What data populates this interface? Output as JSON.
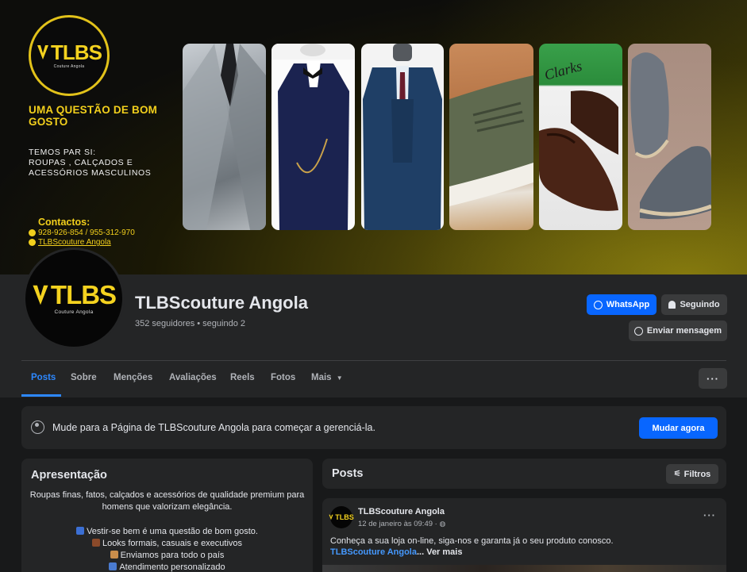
{
  "cover": {
    "logo_text": "TLBS",
    "logo_subtitle": "Couture Angola",
    "headline": "UMA QUESTÃO DE BOM GOSTO",
    "lines": [
      "TEMOS PAR SI:",
      "ROUPAS , CALÇADOS E",
      "ACESSÓRIOS MASCULINOS"
    ],
    "contacts_title": "Contactos:",
    "phone": "928-926-854 / 955-312-970",
    "handle": "TLBScouture Angola",
    "photos": [
      "grey-suit-photo",
      "navy-tuxedo-photo",
      "blue-three-piece-suit-photo",
      "olive-sneaker-photo",
      "clarks-brown-shoes-photo",
      "grey-suede-loafers-photo"
    ]
  },
  "profile": {
    "avatar_text": "TLBS",
    "avatar_subtitle": "Couture Angola",
    "name": "TLBScouture Angola",
    "stats": "352 seguidores • seguindo 2",
    "whatsapp_label": "WhatsApp",
    "follow_label": "Seguindo",
    "message_label": "Enviar mensagem"
  },
  "tabs": [
    "Posts",
    "Sobre",
    "Menções",
    "Avaliações",
    "Reels",
    "Fotos",
    "Mais"
  ],
  "more_icon": "···",
  "manage": {
    "text": "Mude para a Página de TLBScouture Angola para começar a gerenciá-la.",
    "button": "Mudar agora"
  },
  "intro": {
    "title": "Apresentação",
    "description": "Roupas finas, fatos, calçados e acessórios de qualidade premium para homens que valorizam elegância.",
    "items": [
      "Vestir-se bem é uma questão de bom gosto.",
      "Looks formais, casuais e executivos",
      "Enviamos para todo o país",
      "Atendimento personalizado"
    ]
  },
  "posts": {
    "title": "Posts",
    "filter_label": "Filtros",
    "post": {
      "author": "TLBScouture Angola",
      "time": "12 de janeiro às 09:49 ·",
      "text": "Conheça a sua loja on-line, siga-nos e garanta já o seu produto conosco.",
      "link": "TLBScouture Angola",
      "more": "... Ver mais"
    }
  },
  "colors": {
    "accent_blue": "#0866ff",
    "brand_gold": "#f2cf1c",
    "card_bg": "#242526",
    "page_bg": "#18191a"
  }
}
